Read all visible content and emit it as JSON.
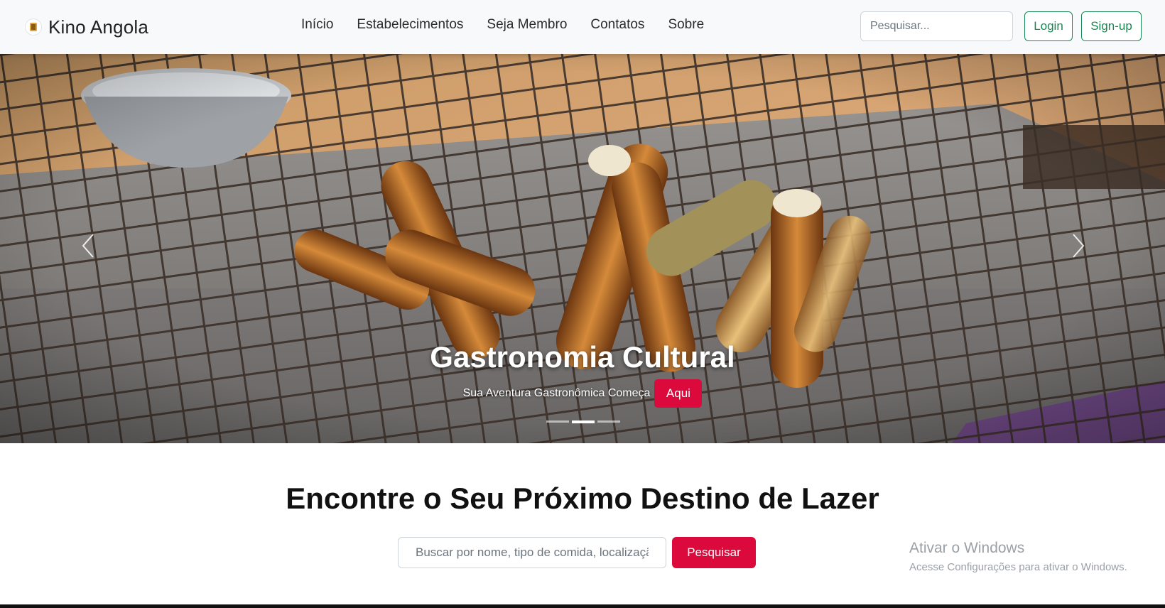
{
  "brand": {
    "name": "Kino Angola"
  },
  "nav": {
    "links": [
      "Início",
      "Estabelecimentos",
      "Seja Membro",
      "Contatos",
      "Sobre"
    ],
    "search_placeholder": "Pesquisar...",
    "login_label": "Login",
    "signup_label": "Sign-up"
  },
  "hero": {
    "title": "Gastronomia Cultural",
    "subtitle": "Sua Aventura Gastronômica Começa",
    "button_label": "Aqui",
    "slide_count": 3,
    "active_slide": 2
  },
  "search_section": {
    "title": "Encontre o Seu Próximo Destino de Lazer",
    "input_placeholder": "Buscar por nome, tipo de comida, localização",
    "button_label": "Pesquisar"
  },
  "watermark": {
    "title": "Ativar o Windows",
    "subtitle": "Acesse Configurações para ativar o Windows."
  },
  "colors": {
    "accent_red": "#dc0a3c",
    "outline_green": "#198754",
    "navbar_bg": "#f8f9fa"
  },
  "icons": {
    "prev": "chevron-left-icon",
    "next": "chevron-right-icon",
    "logo": "brand-logo-icon"
  }
}
